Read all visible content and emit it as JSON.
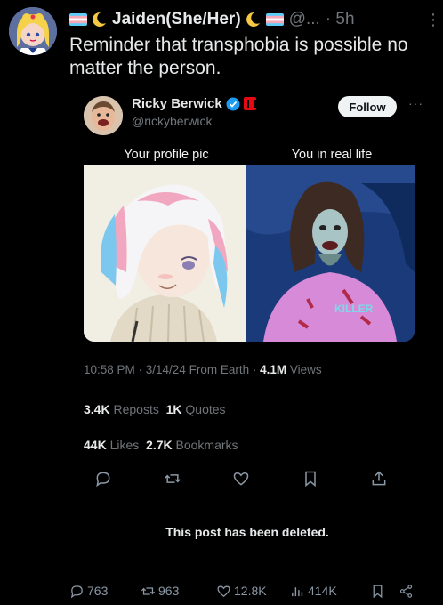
{
  "outer_post": {
    "display_name": "Jaiden(She/Her)",
    "handle": "@...",
    "time": "· 5h",
    "text": "Reminder that transphobia is possible no matter the person."
  },
  "quoted_post": {
    "name": "Ricky Berwick",
    "handle": "@rickyberwick",
    "follow_label": "Follow",
    "meme_caption_left": "Your profile pic",
    "meme_caption_right": "You in real life",
    "time_date": "10:58 PM · 3/14/24 From Earth ·",
    "views_count": "4.1M",
    "views_label": "Views",
    "reposts_count": "3.4K",
    "reposts_label": "Reposts",
    "quotes_count": "1K",
    "quotes_label": "Quotes",
    "likes_count": "44K",
    "likes_label": "Likes",
    "bookmarks_count": "2.7K",
    "bookmarks_label": "Bookmarks",
    "deleted_notice": "This post has been deleted."
  },
  "bottom_actions": {
    "replies": "763",
    "reposts": "963",
    "likes": "12.8K",
    "views": "414K"
  },
  "icons": [
    "trans-flag-icon",
    "crescent-moon-icon",
    "kebab-menu-icon",
    "verified-badge-icon",
    "netflix-badge-icon",
    "more-icon",
    "reply-icon",
    "repost-icon",
    "like-icon",
    "bookmark-icon",
    "share-icon",
    "views-icon"
  ],
  "colors": {
    "background": "#000000",
    "text": "#e7e9ea",
    "muted": "#71767b",
    "verified": "#1d9bf0",
    "netflix": "#e50914"
  }
}
